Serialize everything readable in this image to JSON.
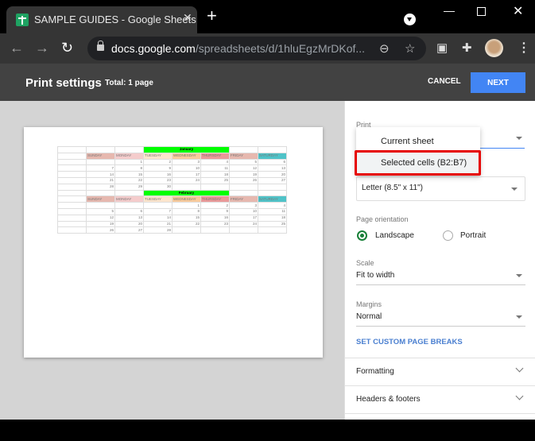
{
  "browser": {
    "tab_title": "SAMPLE GUIDES - Google Sheets",
    "tab_close": "✕",
    "new_tab": "+",
    "url_host": "docs.google.com",
    "url_path": "/spreadsheets/d/1hluEgzMrDKof...",
    "icons": {
      "back": "←",
      "forward": "→",
      "reload": "↻",
      "zoom": "⊖",
      "star": "☆",
      "screenshot": "▣",
      "extensions": "✚",
      "menu": "⋮",
      "minimize": "—",
      "close": "✕"
    }
  },
  "print_settings": {
    "title": "Print settings",
    "total": "Total: 1 page",
    "cancel_label": "CANCEL",
    "next_label": "NEXT"
  },
  "calendar": {
    "days": [
      "SUNDAY",
      "MONDAY",
      "TUESDAY",
      "WEDNESDAY",
      "THURSDAY",
      "FRIDAY",
      "SATURDAY"
    ],
    "day_colors": [
      "#e6b8af",
      "#f4cccc",
      "#fce5cd",
      "#f9cb9c",
      "#ea9999",
      "#e6b8af",
      "#4fc3c8"
    ],
    "months": [
      {
        "name": "January",
        "weeks": [
          [
            "",
            "1",
            "2",
            "3",
            "4",
            "5",
            "6"
          ],
          [
            "7",
            "8",
            "9",
            "10",
            "11",
            "12",
            "13"
          ],
          [
            "14",
            "15",
            "16",
            "17",
            "18",
            "19",
            "20"
          ],
          [
            "21",
            "22",
            "23",
            "24",
            "25",
            "26",
            "27"
          ],
          [
            "28",
            "29",
            "30",
            "",
            "",
            "",
            ""
          ]
        ]
      },
      {
        "name": "February",
        "weeks": [
          [
            "",
            "",
            "",
            "1",
            "2",
            "3",
            "4"
          ],
          [
            "5",
            "6",
            "7",
            "8",
            "9",
            "10",
            "11"
          ],
          [
            "12",
            "13",
            "14",
            "15",
            "16",
            "17",
            "18"
          ],
          [
            "19",
            "20",
            "21",
            "22",
            "23",
            "24",
            "25"
          ],
          [
            "26",
            "27",
            "28",
            "",
            "",
            "",
            ""
          ]
        ]
      }
    ]
  },
  "settings": {
    "print_label": "Print",
    "print_options": [
      "Current sheet",
      "Selected cells (B2:B7)"
    ],
    "paper_size": "Letter (8.5\" x 11\")",
    "orientation_label": "Page orientation",
    "orientation_options": [
      "Landscape",
      "Portrait"
    ],
    "orientation_selected": "Landscape",
    "scale_label": "Scale",
    "scale_value": "Fit to width",
    "margins_label": "Margins",
    "margins_value": "Normal",
    "custom_breaks": "SET CUSTOM PAGE BREAKS",
    "sections": [
      "Formatting",
      "Headers & footers"
    ]
  }
}
